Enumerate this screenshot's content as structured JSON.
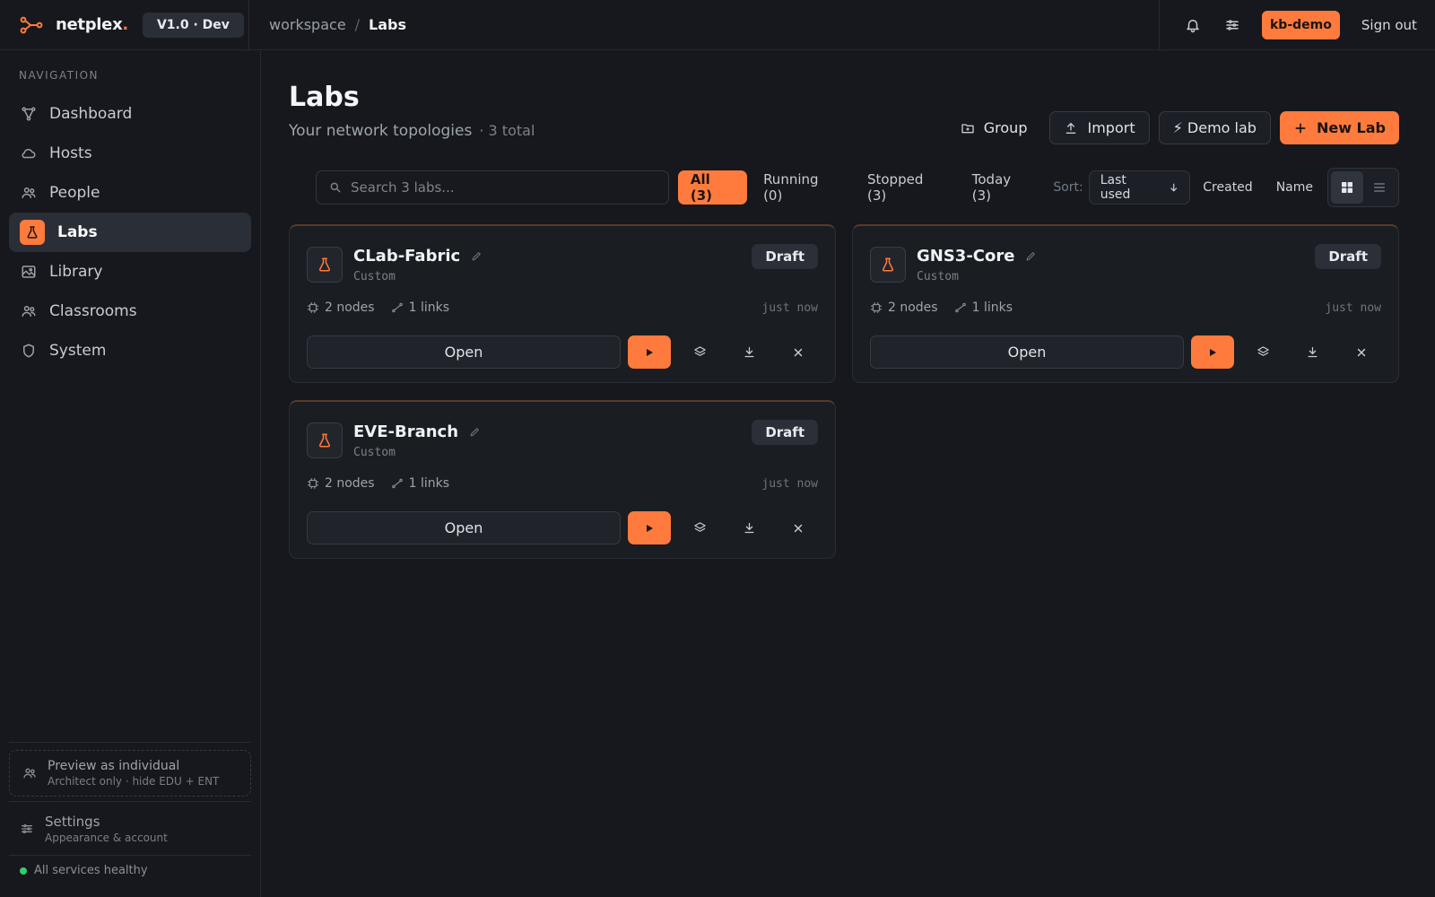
{
  "app": {
    "brand_name": "netplex",
    "brand_dot": ".",
    "version": "V1.0 · Dev",
    "accent_color": "#ff7a3d"
  },
  "breadcrumb": {
    "root": "workspace",
    "separator": "/",
    "current": "Labs"
  },
  "header": {
    "user": "kb-demo",
    "sign_out": "Sign out",
    "icons": [
      "bell-icon",
      "sliders-icon"
    ]
  },
  "sidebar": {
    "title": "NAVIGATION",
    "items": [
      {
        "label": "Dashboard",
        "icon": "graph-icon"
      },
      {
        "label": "Hosts",
        "icon": "cloud-icon"
      },
      {
        "label": "People",
        "icon": "users-icon"
      },
      {
        "label": "Labs",
        "icon": "flask-icon",
        "active": true
      },
      {
        "label": "Library",
        "icon": "image-icon"
      },
      {
        "label": "Classrooms",
        "icon": "users-icon"
      },
      {
        "label": "System",
        "icon": "shield-icon"
      }
    ],
    "preview": {
      "title": "Preview as individual",
      "subtitle": "Architect only · hide EDU + ENT"
    },
    "settings": {
      "title": "Settings",
      "subtitle": "Appearance & account"
    },
    "status": "All services healthy"
  },
  "page": {
    "title": "Labs",
    "subtitle": "Your network topologies",
    "count": "· 3 total",
    "actions": {
      "group": "Group",
      "import": "Import",
      "demo": "⚡ Demo lab",
      "new": "New Lab"
    }
  },
  "filters": {
    "search_placeholder": "Search 3 labs...",
    "chips": [
      "All (3)",
      "Running (0)",
      "Stopped (3)",
      "Today (3)"
    ],
    "active_chip": "All (3)",
    "sort_label": "Sort:",
    "sort_selected": "Last used",
    "sort_options": [
      "Created",
      "Name"
    ],
    "view": "grid"
  },
  "labs": [
    {
      "name": "CLab-Fabric",
      "type": "Custom",
      "status": "Draft",
      "nodes": "2 nodes",
      "links": "1 links",
      "updated": "just now",
      "open_label": "Open"
    },
    {
      "name": "GNS3-Core",
      "type": "Custom",
      "status": "Draft",
      "nodes": "2 nodes",
      "links": "1 links",
      "updated": "just now",
      "open_label": "Open"
    },
    {
      "name": "EVE-Branch",
      "type": "Custom",
      "status": "Draft",
      "nodes": "2 nodes",
      "links": "1 links",
      "updated": "just now",
      "open_label": "Open"
    }
  ]
}
